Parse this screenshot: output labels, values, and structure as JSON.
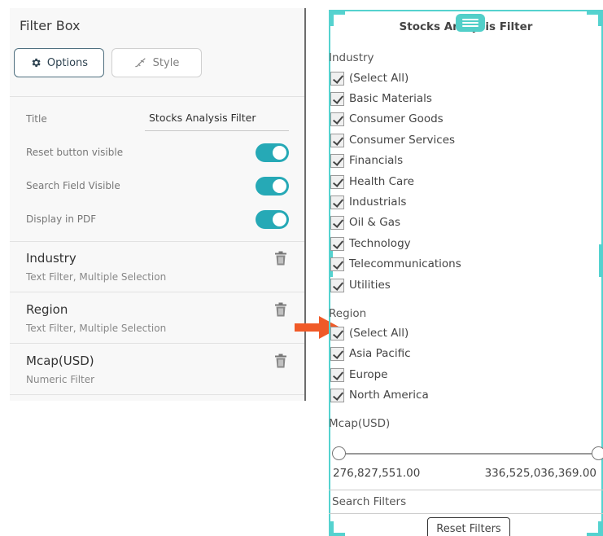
{
  "left_panel": {
    "title": "Filter Box",
    "tabs": [
      {
        "label": "Options",
        "icon": "gear-icon",
        "active": true
      },
      {
        "label": "Style",
        "icon": "brush-icon",
        "active": false
      }
    ],
    "settings": {
      "title_label": "Title",
      "title_value": "Stocks Analysis Filter",
      "toggles": [
        {
          "label": "Reset button visible",
          "on": true
        },
        {
          "label": "Search Field Visible",
          "on": true
        },
        {
          "label": "Display in PDF",
          "on": true
        }
      ]
    },
    "filters": [
      {
        "name": "Industry",
        "description": "Text Filter, Multiple Selection"
      },
      {
        "name": "Region",
        "description": "Text Filter, Multiple Selection"
      },
      {
        "name": "Mcap(USD)",
        "description": "Numeric Filter"
      }
    ]
  },
  "preview": {
    "title": "Stocks Analysis Filter",
    "industry": {
      "label": "Industry",
      "options": [
        "(Select All)",
        "Basic Materials",
        "Consumer Goods",
        "Consumer Services",
        "Financials",
        "Health Care",
        "Industrials",
        "Oil & Gas",
        "Technology",
        "Telecommunications",
        "Utilities"
      ]
    },
    "region": {
      "label": "Region",
      "options": [
        "(Select All)",
        "Asia Pacific",
        "Europe",
        "North America"
      ]
    },
    "mcap": {
      "label": "Mcap(USD)",
      "min": "276,827,551.00",
      "max": "336,525,036,369.00"
    },
    "search_placeholder": "Search Filters",
    "reset_label": "Reset Filters"
  },
  "colors": {
    "accent": "#26a9b6",
    "frame": "#55d2cf",
    "arrow": "#f05a28",
    "options_border": "#4f6f7f"
  }
}
